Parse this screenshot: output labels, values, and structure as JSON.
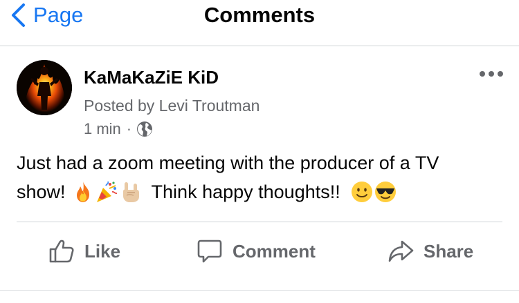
{
  "nav": {
    "back_label": "Page",
    "title": "Comments"
  },
  "post": {
    "author_name": "KaMaKaZiE KiD",
    "posted_by": "Posted by Levi Troutman",
    "time": "1 min",
    "separator": "·",
    "privacy_icon": "globe-icon",
    "text_line1": "Just had a zoom meeting with the producer of a TV",
    "text_line2_prefix": "show!",
    "text_line2_middle": "Think happy thoughts!!",
    "emojis_line2_group1": [
      "fire-emoji",
      "party-popper-emoji",
      "rock-hand-emoji"
    ],
    "emojis_line2_group2": [
      "slightly-smiling-face-emoji",
      "sunglasses-face-emoji"
    ]
  },
  "actions": {
    "like_label": "Like",
    "comment_label": "Comment",
    "share_label": "Share"
  },
  "colors": {
    "accent": "#1877f2",
    "secondary_text": "#65676b",
    "divider": "#cfd2d6"
  }
}
